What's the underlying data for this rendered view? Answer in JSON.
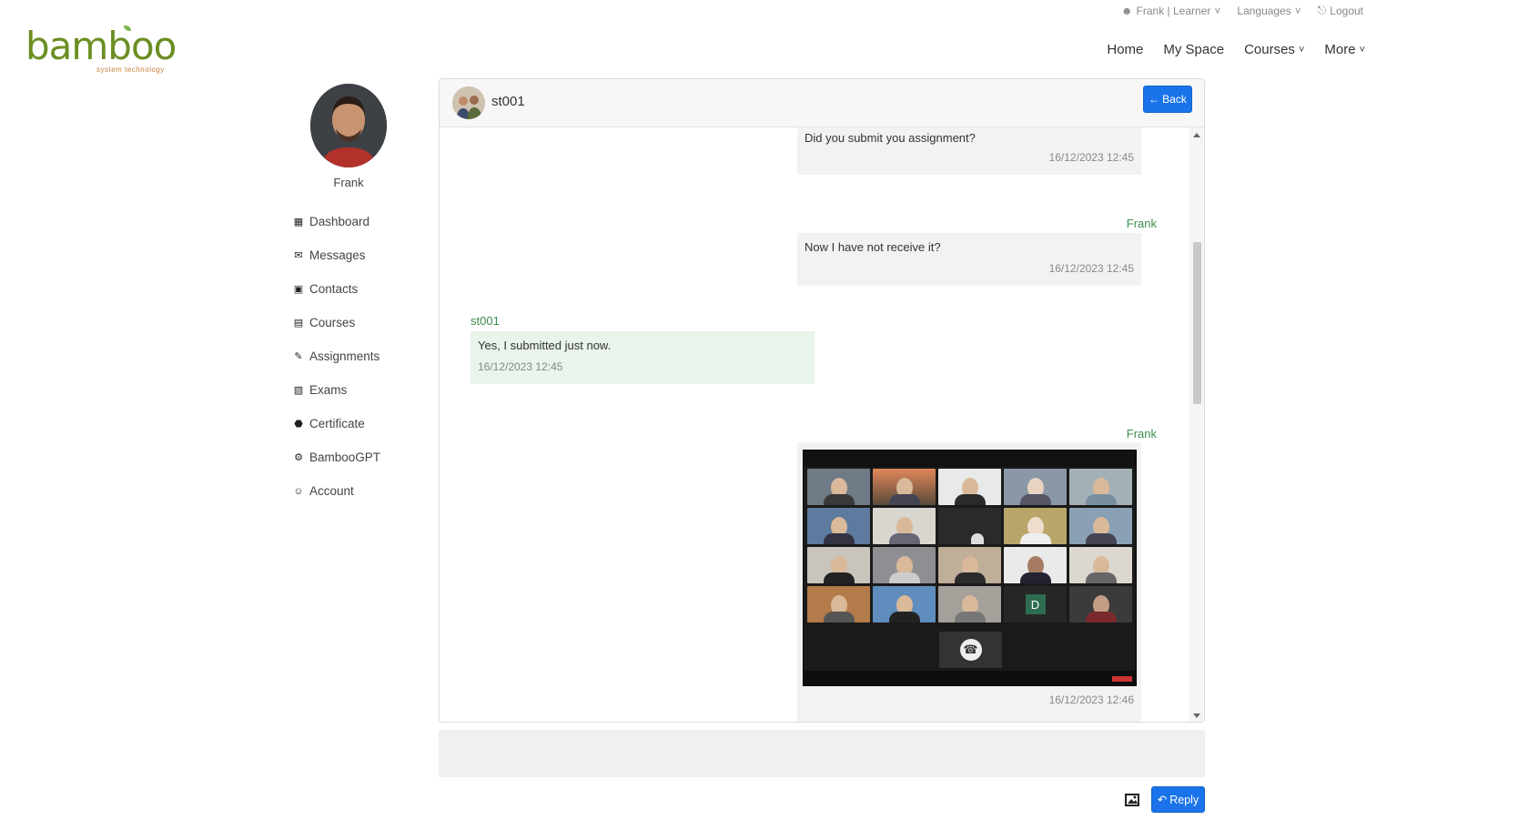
{
  "topbar": {
    "user": "Frank | Learner",
    "languages": "Languages",
    "logout": "Logout"
  },
  "brand": {
    "logo_text": "bamboo",
    "tagline": "system technology",
    "colors": {
      "logo": "#6b8e23",
      "tagline": "#c9803a"
    }
  },
  "nav": {
    "home": "Home",
    "myspace": "My Space",
    "courses": "Courses",
    "more": "More"
  },
  "profile": {
    "name": "Frank"
  },
  "sidebar": {
    "items": [
      {
        "label": "Dashboard",
        "icon": "grid-icon"
      },
      {
        "label": "Messages",
        "icon": "envelope-icon"
      },
      {
        "label": "Contacts",
        "icon": "contact-book-icon"
      },
      {
        "label": "Courses",
        "icon": "book-icon"
      },
      {
        "label": "Assignments",
        "icon": "edit-icon"
      },
      {
        "label": "Exams",
        "icon": "pencil-square-icon"
      },
      {
        "label": "Certificate",
        "icon": "badge-icon"
      },
      {
        "label": "BambooGPT",
        "icon": "gear-icon"
      },
      {
        "label": "Account",
        "icon": "user-icon"
      }
    ]
  },
  "chat": {
    "contact": "st001",
    "back_label": "Back",
    "messages": [
      {
        "sender": "",
        "text": "Did you submit you assignment?",
        "time": "16/12/2023 12:45",
        "side": "right"
      },
      {
        "sender": "Frank",
        "text": "Now I have not receive it?",
        "time": "16/12/2023 12:45",
        "side": "right"
      },
      {
        "sender": "st001",
        "text": "Yes, I submitted just now.",
        "time": "16/12/2023 12:45",
        "side": "left"
      },
      {
        "sender": "Frank",
        "text": "",
        "time": "16/12/2023 12:46",
        "side": "right",
        "attachment": "video-call-screenshot"
      }
    ],
    "zoom_tile_letter": "D"
  },
  "compose": {
    "reply_label": "Reply",
    "attach_icon": "image-icon"
  },
  "accent": "#1a73e8",
  "sender_color": "#3d8d4d"
}
